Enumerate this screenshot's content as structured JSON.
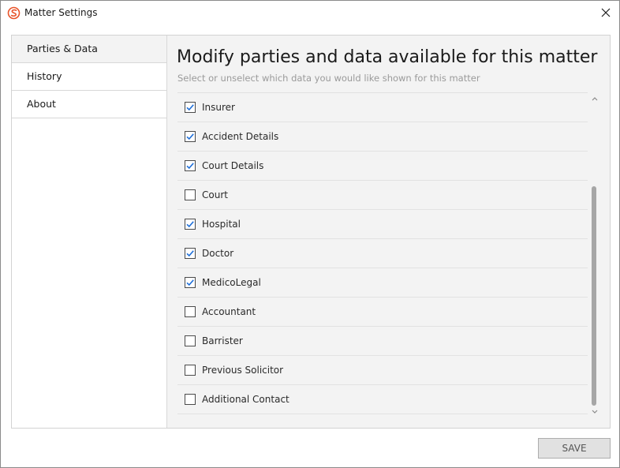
{
  "window": {
    "title": "Matter Settings"
  },
  "sidebar": {
    "items": [
      {
        "label": "Parties & Data",
        "active": true
      },
      {
        "label": "History",
        "active": false
      },
      {
        "label": "About",
        "active": false
      }
    ]
  },
  "content": {
    "heading": "Modify parties and data available for this matter",
    "subheading": "Select or unselect which data you would like shown for this matter",
    "items": [
      {
        "label": "Insurer",
        "checked": true
      },
      {
        "label": "Accident Details",
        "checked": true
      },
      {
        "label": "Court Details",
        "checked": true
      },
      {
        "label": "Court",
        "checked": false
      },
      {
        "label": "Hospital",
        "checked": true
      },
      {
        "label": "Doctor",
        "checked": true
      },
      {
        "label": "MedicoLegal",
        "checked": true
      },
      {
        "label": "Accountant",
        "checked": false
      },
      {
        "label": "Barrister",
        "checked": false
      },
      {
        "label": "Previous Solicitor",
        "checked": false
      },
      {
        "label": "Additional Contact",
        "checked": false
      }
    ]
  },
  "footer": {
    "save_label": "SAVE"
  },
  "colors": {
    "accent": "#1e6fd9",
    "brand": "#e8542a"
  },
  "icons": {
    "app": "app-logo-icon",
    "close": "close-icon",
    "check": "checkmark-icon",
    "scroll_up": "chevron-up-icon",
    "scroll_down": "chevron-down-icon"
  }
}
